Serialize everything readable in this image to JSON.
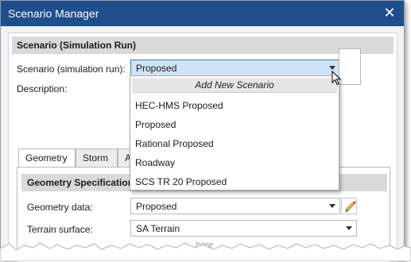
{
  "window": {
    "title": "Scenario Manager",
    "close_label": "✕"
  },
  "section": {
    "title": "Scenario (Simulation Run)"
  },
  "scenario": {
    "label": "Scenario (simulation run):",
    "value": "Proposed"
  },
  "description": {
    "label": "Description:"
  },
  "dropdown": {
    "add_label": "Add New Scenario",
    "items": [
      "HEC-HMS Proposed",
      "Proposed",
      "Rational Proposed",
      "Roadway",
      "SCS TR 20 Proposed"
    ]
  },
  "tabs": [
    "Geometry",
    "Storm",
    "A"
  ],
  "geometry": {
    "section_title": "Geometry Specifications",
    "geometry_label": "Geometry data:",
    "geometry_value": "Proposed",
    "terrain_label": "Terrain surface:",
    "terrain_value": "SA Terrain"
  },
  "ghost": "here"
}
